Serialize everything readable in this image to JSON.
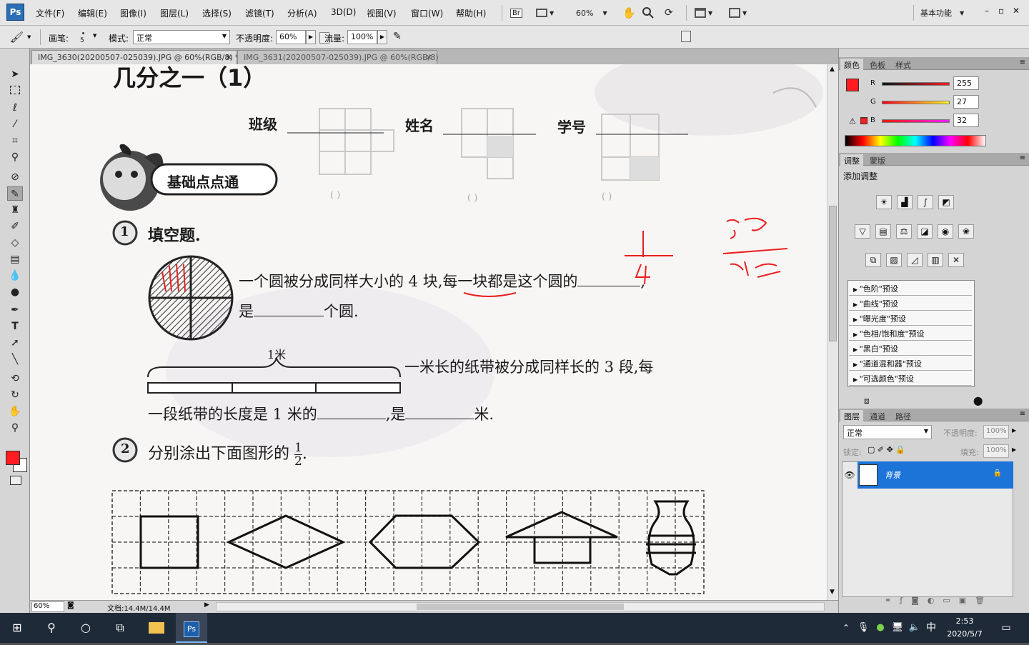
{
  "app": {
    "logo": "Ps"
  },
  "menubar": {
    "items": [
      "文件(F)",
      "编辑(E)",
      "图像(I)",
      "图层(L)",
      "选择(S)",
      "滤镜(T)",
      "分析(A)",
      "3D(D)",
      "视图(V)",
      "窗口(W)",
      "帮助(H)"
    ],
    "bridge": "Br",
    "zoom": "60%",
    "workspace": "基本功能",
    "win_min": "–",
    "win_restore": "▫",
    "win_close": "✕"
  },
  "options": {
    "brush_label": "画笔:",
    "brush_size": "5",
    "mode_label": "模式:",
    "mode_value": "正常",
    "opacity_label": "不透明度:",
    "opacity_value": "60%",
    "flow_label": "流量:",
    "flow_value": "100%"
  },
  "tabs": [
    {
      "title": "IMG_3630(20200507-025039).JPG @ 60%(RGB/8) *",
      "close": "✕"
    },
    {
      "title": "IMG_3631(20200507-025039).JPG @ 60%(RGB/8)",
      "close": "✕"
    }
  ],
  "document": {
    "title": "几分之一（1）",
    "class_label": "班级",
    "name_label": "姓名",
    "id_label": "学号",
    "badge": "基础点点通",
    "q1_num": "1",
    "q1_title": "填空题.",
    "q1_line1": "一个圆被分成同样大小的 4 块,每一块都是这个圆的",
    "q1_line1_end": ",",
    "q1_line2a": "是",
    "q1_line2b": "个圆.",
    "meter_label": "1米",
    "q1_tape1": "一米长的纸带被分成同样长的 3 段,每",
    "q1_tape2a": "一段纸带的长度是 1 米的",
    "q1_tape2b": ",是",
    "q1_tape2c": "米.",
    "q2_num": "2",
    "q2_text": "分别涂出下面图形的",
    "q2_frac_num": "1",
    "q2_frac_den": "2",
    "q2_end": ".",
    "paren": "(    )",
    "annot_fraction_num": "1",
    "annot_fraction_den": "4",
    "annot_word_top": "分子",
    "annot_word_bottom": "分母"
  },
  "status": {
    "zoom": "60%",
    "doc_size": "文档:14.4M/14.4M"
  },
  "color_panel": {
    "tabs": [
      "颜色",
      "色板",
      "样式"
    ],
    "r_label": "R",
    "r_value": "255",
    "g_label": "G",
    "g_value": "27",
    "b_label": "B",
    "b_value": "32",
    "fg_color": "#ff1b20"
  },
  "adjust_panel": {
    "tabs": [
      "调整",
      "蒙版"
    ],
    "add_label": "添加调整",
    "presets": [
      "\"色阶\"预设",
      "\"曲线\"预设",
      "\"曝光度\"预设",
      "\"色相/饱和度\"预设",
      "\"黑白\"预设",
      "\"通道混和器\"预设",
      "\"可选颜色\"预设"
    ]
  },
  "layers_panel": {
    "tabs": [
      "图层",
      "通道",
      "路径"
    ],
    "blend_mode": "正常",
    "opacity_label": "不透明度:",
    "opacity_value": "100%",
    "lock_label": "锁定:",
    "fill_label": "填充:",
    "fill_value": "100%",
    "layer_name": "背景"
  },
  "taskbar": {
    "ime": "中",
    "time": "2:53",
    "date": "2020/5/7",
    "ps_label": "Ps"
  }
}
